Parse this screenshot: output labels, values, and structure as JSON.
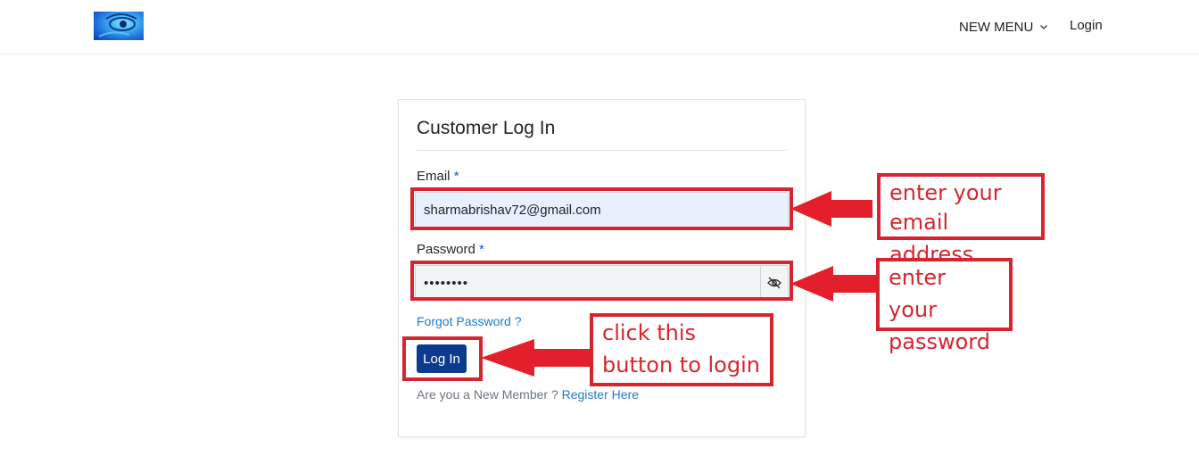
{
  "header": {
    "logo_name": "eye-logo",
    "menu_label": "NEW MENU",
    "login_label": "Login"
  },
  "card": {
    "title": "Customer Log In",
    "email_label": "Email",
    "password_label": "Password",
    "required_mark": "*",
    "email_value": "sharmabrishav72@gmail.com",
    "password_value": "••••••••",
    "forgot_label": "Forgot Password ?",
    "login_button": "Log In",
    "register_prompt": "Are you a New Member ?",
    "register_link": "Register Here"
  },
  "annotations": {
    "email_line1": "enter your",
    "email_line2": "email address",
    "password_line1": "enter your",
    "password_line2": "password",
    "button_line1": "click this",
    "button_line2": "button to login",
    "color": "#d6252f"
  },
  "colors": {
    "primary_button": "#0c3a8e",
    "link": "#1f7ac9",
    "autofill_bg": "#e8f0fe"
  }
}
